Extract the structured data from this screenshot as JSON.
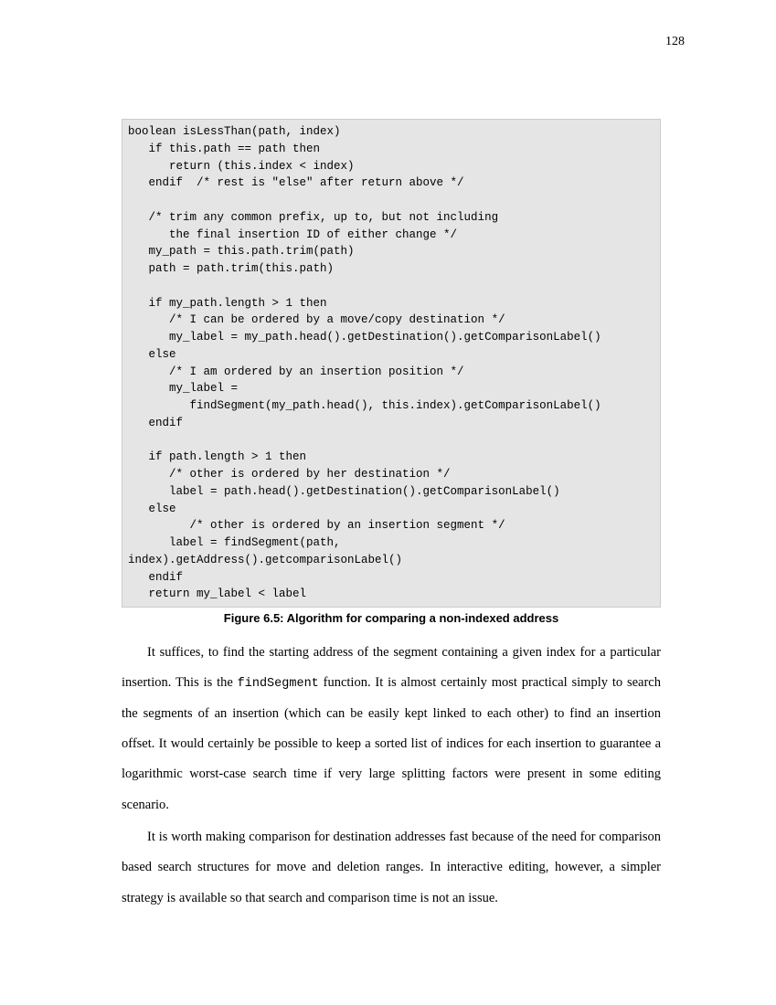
{
  "page_number": "128",
  "code": "boolean isLessThan(path, index)\n   if this.path == path then\n      return (this.index < index)\n   endif  /* rest is \"else\" after return above */\n\n   /* trim any common prefix, up to, but not including\n      the final insertion ID of either change */\n   my_path = this.path.trim(path)\n   path = path.trim(this.path)\n\n   if my_path.length > 1 then\n      /* I can be ordered by a move/copy destination */\n      my_label = my_path.head().getDestination().getComparisonLabel()\n   else\n      /* I am ordered by an insertion position */\n      my_label =\n         findSegment(my_path.head(), this.index).getComparisonLabel()\n   endif\n\n   if path.length > 1 then\n      /* other is ordered by her destination */\n      label = path.head().getDestination().getComparisonLabel()\n   else\n         /* other is ordered by an insertion segment */\n      label = findSegment(path,\nindex).getAddress().getcomparisonLabel()\n   endif\n   return my_label < label",
  "figure_caption": "Figure 6.5: Algorithm for comparing a non-indexed address",
  "para1_part1": "It suffices, to find the starting address of the segment containing a given index for a particular insertion. This is the ",
  "para1_code": "findSegment",
  "para1_part2": " function. It is almost certainly most practical simply to search the segments of an insertion (which can be easily kept linked to each other) to find an insertion offset. It would certainly be possible to keep a sorted list of indices for each insertion to guarantee a logarithmic worst-case search time if very large splitting factors were present in some editing scenario.",
  "para2": "It is worth making comparison for destination addresses fast because of the need for comparison based search structures for move and deletion ranges. In interactive editing, however, a simpler strategy is available so that search and comparison time is not an issue."
}
